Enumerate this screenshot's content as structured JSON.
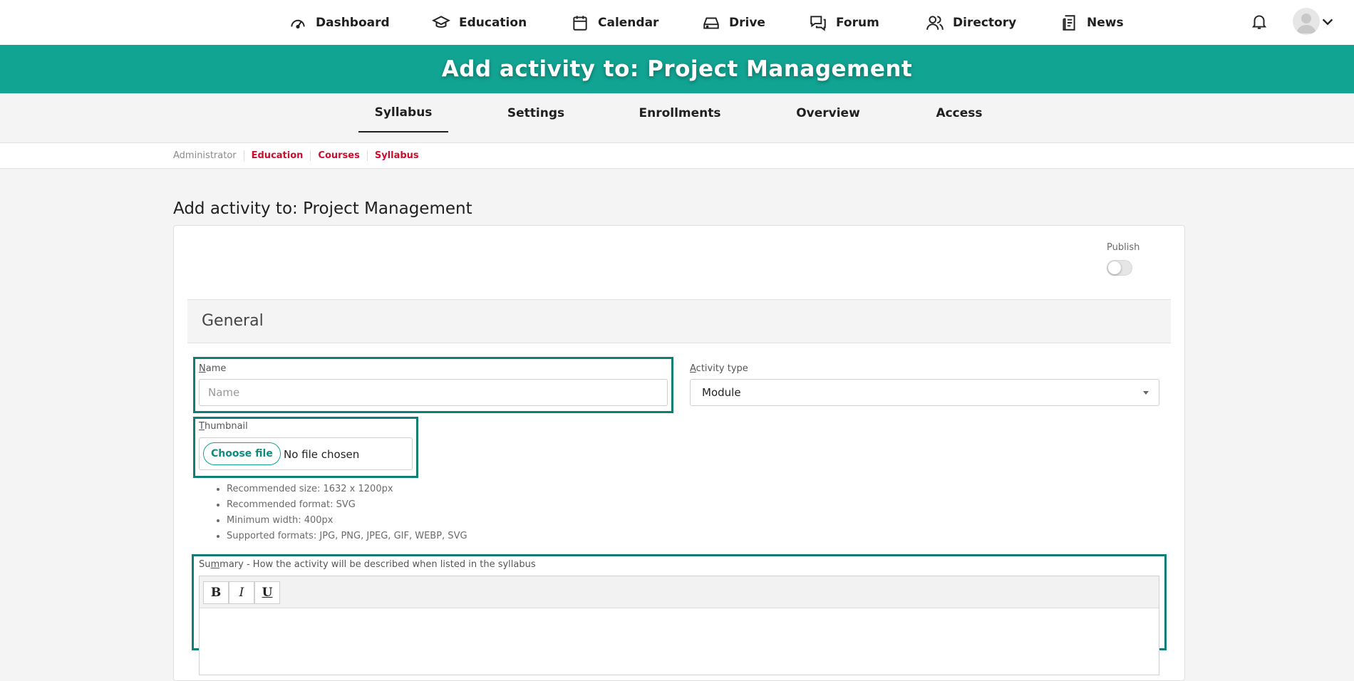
{
  "nav": {
    "items": [
      {
        "label": "Dashboard",
        "icon": "dashboard-icon"
      },
      {
        "label": "Education",
        "icon": "graduation-cap-icon"
      },
      {
        "label": "Calendar",
        "icon": "calendar-icon"
      },
      {
        "label": "Drive",
        "icon": "drive-icon"
      },
      {
        "label": "Forum",
        "icon": "forum-icon"
      },
      {
        "label": "Directory",
        "icon": "users-icon"
      },
      {
        "label": "News",
        "icon": "news-icon"
      }
    ],
    "notifications_icon": "bell-icon",
    "user_icon": "user-avatar-icon"
  },
  "banner": {
    "title": "Add activity to: Project Management",
    "color": "#12a493"
  },
  "tabs": [
    "Syllabus",
    "Settings",
    "Enrollments",
    "Overview",
    "Access"
  ],
  "active_tab": "Syllabus",
  "breadcrumb": [
    "Administrator",
    "Education",
    "Courses",
    "Syllabus"
  ],
  "page_title": "Add activity to: Project Management",
  "form": {
    "publish_label": "Publish",
    "publish_on": false,
    "section_title": "General",
    "name_label_first": "N",
    "name_label_rest": "ame",
    "name_placeholder": "Name",
    "name_value": "",
    "activity_label_first": "A",
    "activity_label_rest": "ctivity type",
    "activity_value": "Module",
    "thumbnail_label_first": "T",
    "thumbnail_label_rest": "humbnail",
    "choose_file_label": "Choose file",
    "file_status": "No file chosen",
    "hints": [
      "Recommended size: 1632 x 1200px",
      "Recommended format: SVG",
      "Minimum width: 400px",
      "Supported formats: JPG, PNG, JPEG, GIF, WEBP, SVG"
    ],
    "summary_label_a": "Su",
    "summary_label_m": "m",
    "summary_label_b": "mary - How the activity will be described when listed in the syllabus",
    "toolbar": {
      "bold": "B",
      "italic": "I",
      "underline": "U"
    }
  },
  "colors": {
    "accent": "#12a493",
    "highlight": "#0f7e74",
    "breadcrumb_link": "#c8102e"
  }
}
